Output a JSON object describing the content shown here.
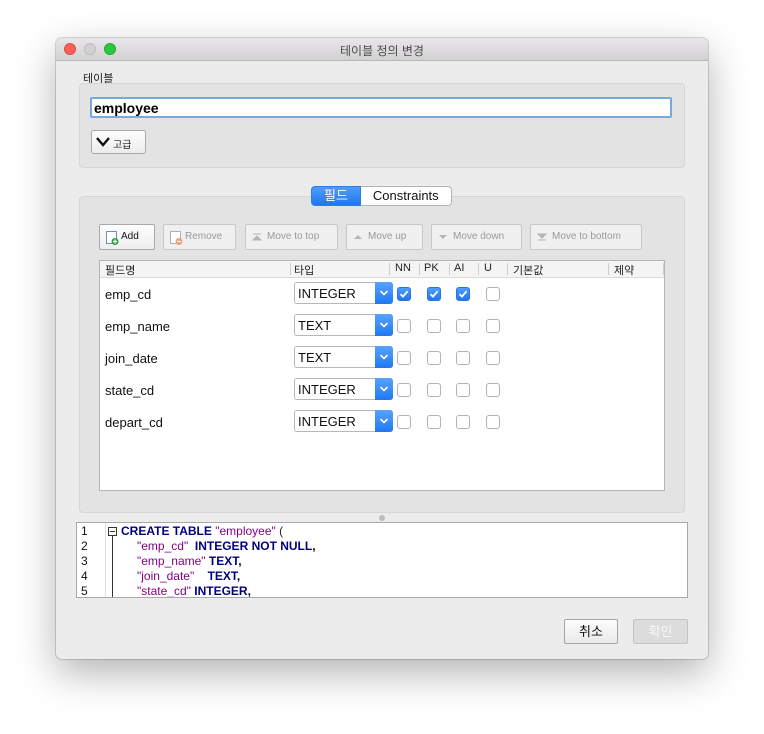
{
  "window": {
    "title": "테이블 정의 변경"
  },
  "table_section": {
    "label": "테이블",
    "name_value": "employee",
    "advanced_label": "고급"
  },
  "tabs": [
    {
      "label": "필드",
      "active": true
    },
    {
      "label": "Constraints",
      "active": false
    }
  ],
  "toolbar": {
    "add": "Add",
    "remove": "Remove",
    "move_top": "Move to top",
    "move_up": "Move up",
    "move_down": "Move down",
    "move_bottom": "Move to bottom"
  },
  "columns": {
    "name": "필드명",
    "type": "타입",
    "nn": "NN",
    "pk": "PK",
    "ai": "AI",
    "u": "U",
    "default": "기본값",
    "constraint": "제약"
  },
  "fields": [
    {
      "name": "emp_cd",
      "type": "INTEGER",
      "nn": true,
      "pk": true,
      "ai": true,
      "u": false
    },
    {
      "name": "emp_name",
      "type": "TEXT",
      "nn": false,
      "pk": false,
      "ai": false,
      "u": false
    },
    {
      "name": "join_date",
      "type": "TEXT",
      "nn": false,
      "pk": false,
      "ai": false,
      "u": false
    },
    {
      "name": "state_cd",
      "type": "INTEGER",
      "nn": false,
      "pk": false,
      "ai": false,
      "u": false
    },
    {
      "name": "depart_cd",
      "type": "INTEGER",
      "nn": false,
      "pk": false,
      "ai": false,
      "u": false
    }
  ],
  "sql": {
    "line_numbers": [
      "1",
      "2",
      "3",
      "4",
      "5"
    ],
    "l1_kw": "CREATE TABLE",
    "l1_str": "\"employee\"",
    "l1_pun": " (",
    "l2_str": "\"emp_cd\"",
    "l2_kw": "INTEGER NOT NULL",
    "l2_pun": ",",
    "l3_str": "\"emp_name\"",
    "l3_kw": "TEXT",
    "l3_pun": ",",
    "l4_str": "\"join_date\"",
    "l4_kw": "TEXT",
    "l4_pun": ",",
    "l5_str": "\"state_cd\"",
    "l5_kw": "INTEGER",
    "l5_pun": ","
  },
  "buttons": {
    "cancel": "취소",
    "ok": "확인"
  },
  "colors": {
    "accent": "#1f77f3",
    "keyword": "#00007f",
    "string": "#7f007f"
  }
}
